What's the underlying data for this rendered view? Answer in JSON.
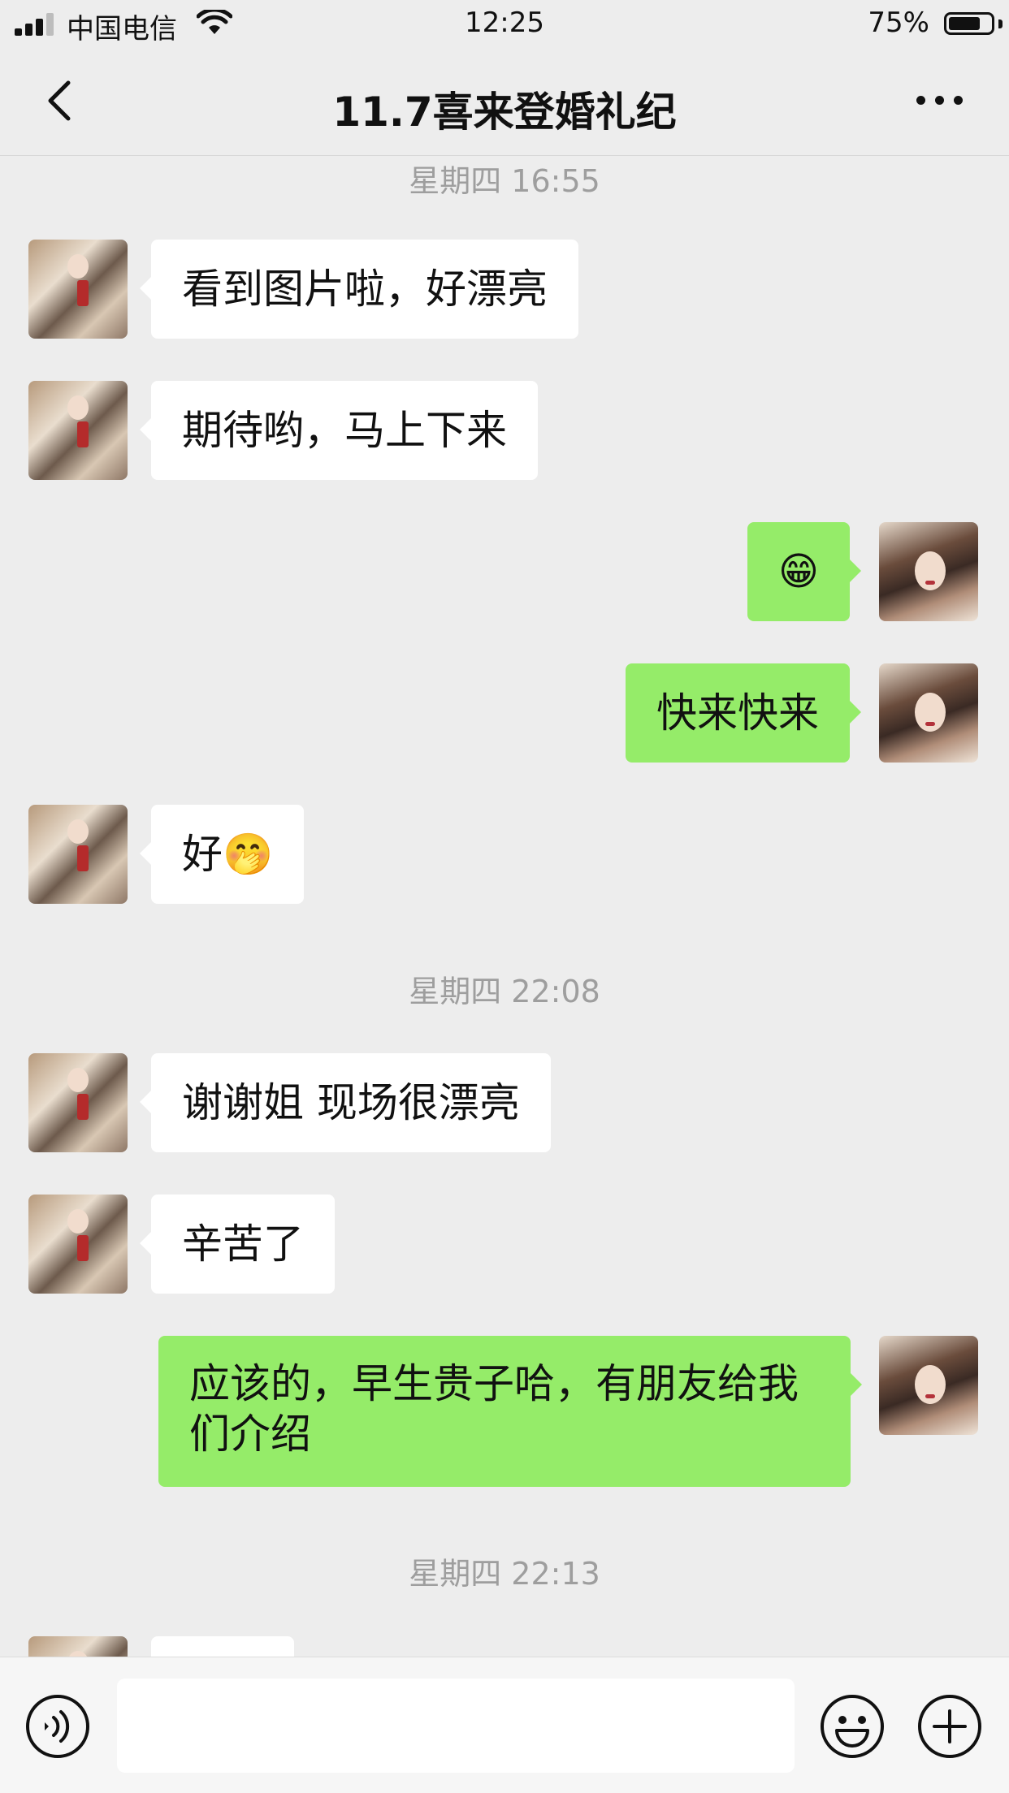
{
  "status_bar": {
    "carrier": "中国电信",
    "time": "12:25",
    "battery": "75%",
    "battery_level": 0.75
  },
  "nav": {
    "title": "11.7喜来登婚礼纪"
  },
  "messages": [
    {
      "type": "time",
      "text": "星期四 16:55"
    },
    {
      "type": "text",
      "from": "them",
      "text": "看到图片啦，好漂亮"
    },
    {
      "type": "text",
      "from": "them",
      "text": "期待哟，马上下来"
    },
    {
      "type": "text",
      "from": "me",
      "text": "😁"
    },
    {
      "type": "text",
      "from": "me",
      "text": "快来快来"
    },
    {
      "type": "text",
      "from": "them",
      "text": "好🤭"
    },
    {
      "type": "time",
      "text": "星期四 22:08"
    },
    {
      "type": "text",
      "from": "them",
      "text": "谢谢姐 现场很漂亮"
    },
    {
      "type": "text",
      "from": "them",
      "text": "辛苦了"
    },
    {
      "type": "text",
      "from": "me",
      "text": "应该的，早生贵子哈，有朋友给我们介绍"
    },
    {
      "type": "time",
      "text": "星期四 22:13"
    }
  ],
  "input": {
    "placeholder": "",
    "value": ""
  },
  "icons": {
    "back": "chevron-left-icon",
    "more": "more-dots-icon",
    "voice": "voice-icon",
    "emoji": "emoji-icon",
    "plus": "plus-icon"
  },
  "colors": {
    "background": "#ededed",
    "my_bubble": "#95ec69",
    "their_bubble": "#ffffff",
    "timestamp": "#9e9e9e"
  }
}
